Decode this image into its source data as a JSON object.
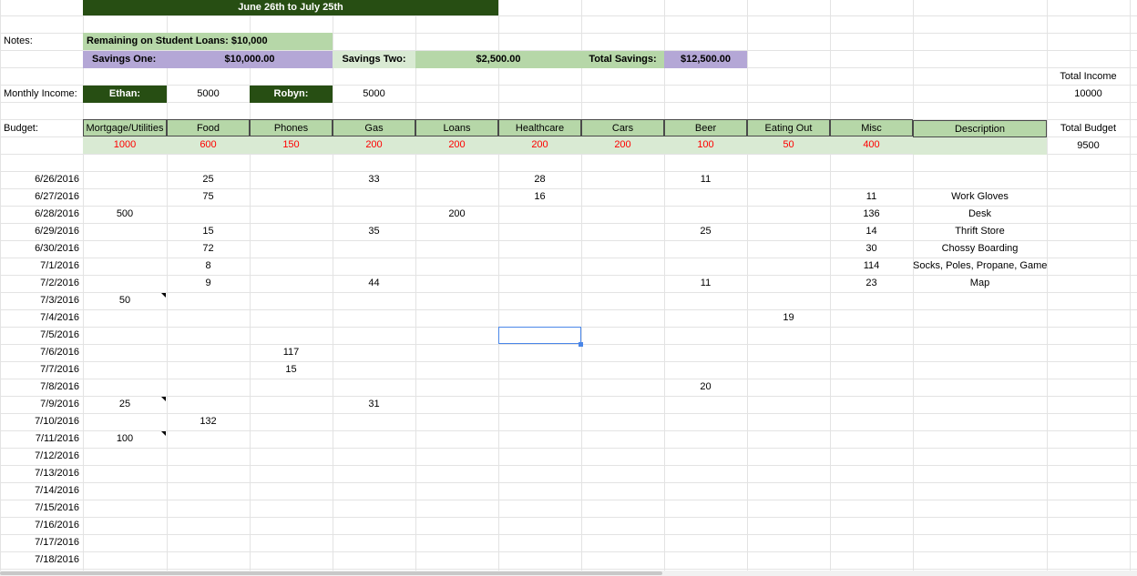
{
  "header": {
    "title": "June 26th to July 25th"
  },
  "notes_label": "Notes:",
  "loans_note": "Remaining on Student Loans: $10,000",
  "savings": {
    "one_label": "Savings One:",
    "one_value": "$10,000.00",
    "two_label": "Savings Two:",
    "two_value": "$2,500.00",
    "total_label": "Total Savings:",
    "total_value": "$12,500.00"
  },
  "income": {
    "label": "Monthly Income:",
    "person1": "Ethan:",
    "person1_value": "5000",
    "person2": "Robyn:",
    "person2_value": "5000",
    "total_label": "Total Income",
    "total_value": "10000"
  },
  "budget": {
    "label": "Budget:",
    "categories": [
      "Mortgage/Utilities",
      "Food",
      "Phones",
      "Gas",
      "Loans",
      "Healthcare",
      "Cars",
      "Beer",
      "Eating Out",
      "Misc"
    ],
    "amounts": [
      "1000",
      "600",
      "150",
      "200",
      "200",
      "200",
      "200",
      "100",
      "50",
      "400"
    ],
    "description_label": "Description",
    "total_label": "Total Budget",
    "total_value": "9500"
  },
  "ledger": [
    {
      "date": "6/26/2016",
      "values": [
        "",
        "25",
        "",
        "33",
        "",
        "28",
        "",
        "11",
        "",
        ""
      ],
      "desc": ""
    },
    {
      "date": "6/27/2016",
      "values": [
        "",
        "75",
        "",
        "",
        "",
        "16",
        "",
        "",
        "",
        "11"
      ],
      "desc": "Work Gloves"
    },
    {
      "date": "6/28/2016",
      "values": [
        "500",
        "",
        "",
        "",
        "200",
        "",
        "",
        "",
        "",
        "136"
      ],
      "desc": "Desk"
    },
    {
      "date": "6/29/2016",
      "values": [
        "",
        "15",
        "",
        "35",
        "",
        "",
        "",
        "25",
        "",
        "14"
      ],
      "desc": "Thrift Store"
    },
    {
      "date": "6/30/2016",
      "values": [
        "",
        "72",
        "",
        "",
        "",
        "",
        "",
        "",
        "",
        "30"
      ],
      "desc": "Chossy Boarding"
    },
    {
      "date": "7/1/2016",
      "values": [
        "",
        "8",
        "",
        "",
        "",
        "",
        "",
        "",
        "",
        "114"
      ],
      "desc": "Socks, Poles, Propane, Game"
    },
    {
      "date": "7/2/2016",
      "values": [
        "",
        "9",
        "",
        "44",
        "",
        "",
        "",
        "11",
        "",
        "23"
      ],
      "desc": "Map"
    },
    {
      "date": "7/3/2016",
      "values": [
        "50",
        "",
        "",
        "",
        "",
        "",
        "",
        "",
        "",
        ""
      ],
      "desc": ""
    },
    {
      "date": "7/4/2016",
      "values": [
        "",
        "",
        "",
        "",
        "",
        "",
        "",
        "",
        "19",
        ""
      ],
      "desc": ""
    },
    {
      "date": "7/5/2016",
      "values": [
        "",
        "",
        "",
        "",
        "",
        "",
        "",
        "",
        "",
        ""
      ],
      "desc": ""
    },
    {
      "date": "7/6/2016",
      "values": [
        "",
        "",
        "117",
        "",
        "",
        "",
        "",
        "",
        "",
        ""
      ],
      "desc": ""
    },
    {
      "date": "7/7/2016",
      "values": [
        "",
        "",
        "15",
        "",
        "",
        "",
        "",
        "",
        "",
        ""
      ],
      "desc": ""
    },
    {
      "date": "7/8/2016",
      "values": [
        "",
        "",
        "",
        "",
        "",
        "",
        "",
        "20",
        "",
        ""
      ],
      "desc": ""
    },
    {
      "date": "7/9/2016",
      "values": [
        "25",
        "",
        "",
        "31",
        "",
        "",
        "",
        "",
        "",
        ""
      ],
      "desc": ""
    },
    {
      "date": "7/10/2016",
      "values": [
        "",
        "132",
        "",
        "",
        "",
        "",
        "",
        "",
        "",
        ""
      ],
      "desc": ""
    },
    {
      "date": "7/11/2016",
      "values": [
        "100",
        "",
        "",
        "",
        "",
        "",
        "",
        "",
        "",
        ""
      ],
      "desc": ""
    },
    {
      "date": "7/12/2016",
      "values": [
        "",
        "",
        "",
        "",
        "",
        "",
        "",
        "",
        "",
        ""
      ],
      "desc": ""
    },
    {
      "date": "7/13/2016",
      "values": [
        "",
        "",
        "",
        "",
        "",
        "",
        "",
        "",
        "",
        ""
      ],
      "desc": ""
    },
    {
      "date": "7/14/2016",
      "values": [
        "",
        "",
        "",
        "",
        "",
        "",
        "",
        "",
        "",
        ""
      ],
      "desc": ""
    },
    {
      "date": "7/15/2016",
      "values": [
        "",
        "",
        "",
        "",
        "",
        "",
        "",
        "",
        "",
        ""
      ],
      "desc": ""
    },
    {
      "date": "7/16/2016",
      "values": [
        "",
        "",
        "",
        "",
        "",
        "",
        "",
        "",
        "",
        ""
      ],
      "desc": ""
    },
    {
      "date": "7/17/2016",
      "values": [
        "",
        "",
        "",
        "",
        "",
        "",
        "",
        "",
        "",
        ""
      ],
      "desc": ""
    },
    {
      "date": "7/18/2016",
      "values": [
        "",
        "",
        "",
        "",
        "",
        "",
        "",
        "",
        "",
        ""
      ],
      "desc": ""
    }
  ],
  "comment_marker_rows": [
    7,
    13,
    15
  ],
  "colors": {
    "dark_green": "#274e13",
    "light_green": "#b6d7a8",
    "purple": "#b4a7d6",
    "pale_green": "#d9ead3",
    "budget_red": "#ff0000",
    "selection_blue": "#4a86e8",
    "gridline": "#e3e3e3"
  }
}
